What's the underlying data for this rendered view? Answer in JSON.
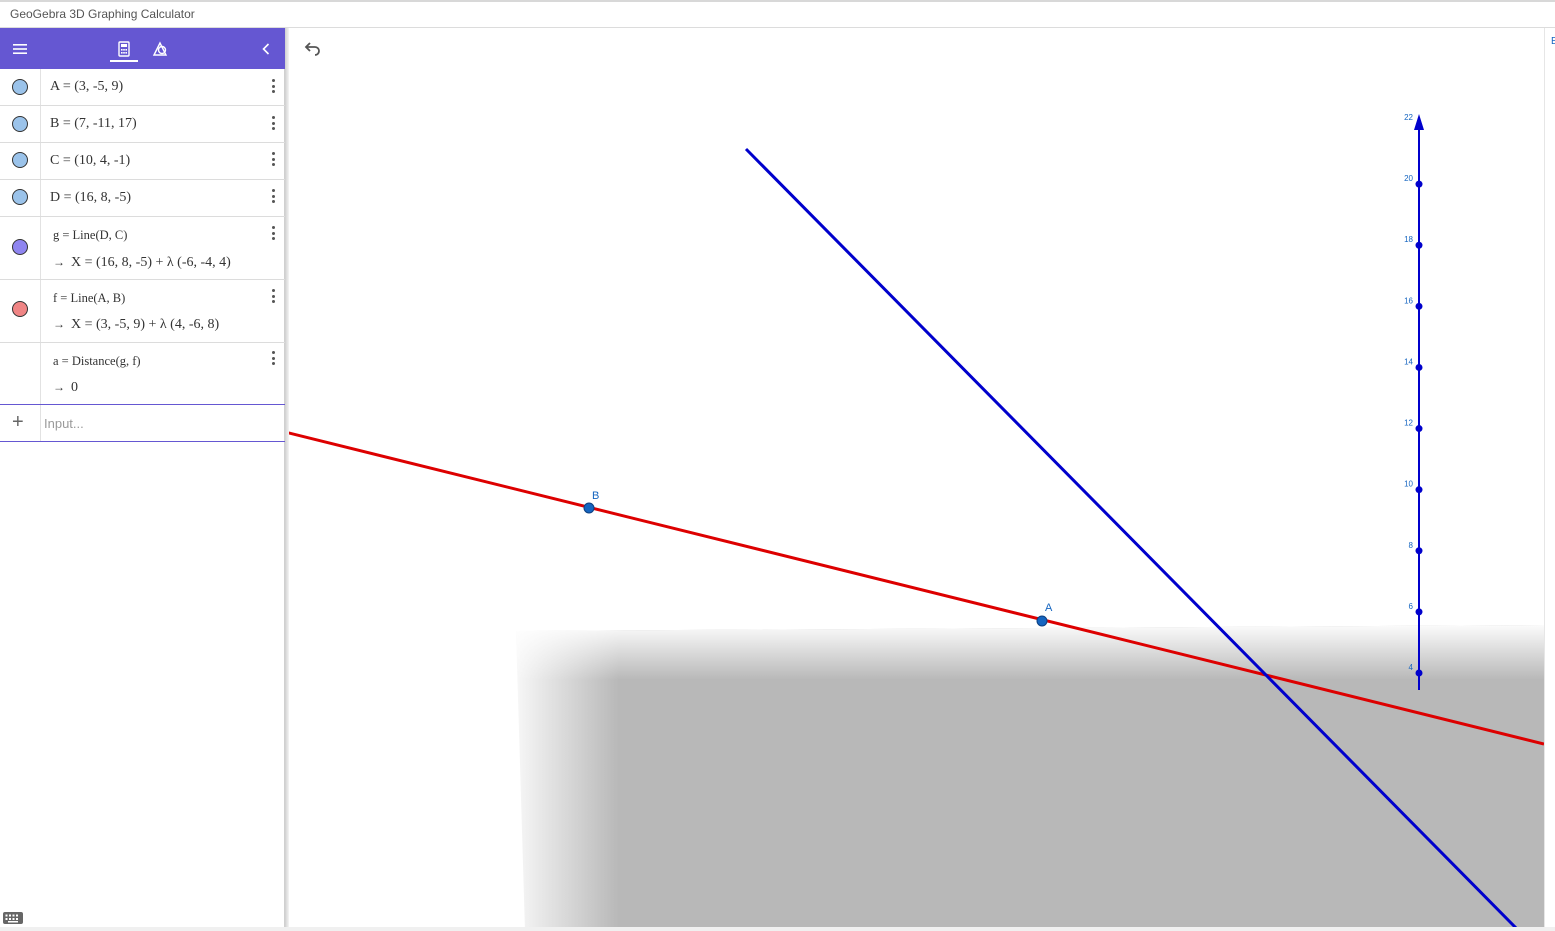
{
  "window": {
    "title": "GeoGebra 3D Graphing Calculator"
  },
  "algebra_view": {
    "rows": [
      {
        "definition": "A = (3, -5, 9)",
        "marble_color": "#9bc3ea",
        "output": ""
      },
      {
        "definition": "B = (7, -11, 17)",
        "marble_color": "#9bc3ea",
        "output": ""
      },
      {
        "definition": "C = (10, 4, -1)",
        "marble_color": "#9bc3ea",
        "output": ""
      },
      {
        "definition": "D = (16, 8, -5)",
        "marble_color": "#9bc3ea",
        "output": ""
      },
      {
        "definition": "g = Line(D, C)",
        "marble_color": "#8f85f0",
        "output": "X = (16, 8, -5) + λ (-6, -4, 4)"
      },
      {
        "definition": "f = Line(A, B)",
        "marble_color": "#f08585",
        "output": "X = (3, -5, 9) + λ (4, -6, 8)"
      },
      {
        "definition": "a = Distance(g, f)",
        "marble_color": "",
        "output": "0"
      }
    ],
    "output_arrow": "→",
    "input": {
      "placeholder": "Input..."
    }
  },
  "graphics_3d": {
    "points": [
      {
        "label": "A"
      },
      {
        "label": "B"
      }
    ],
    "z_axis_ticks": [
      "4",
      "6",
      "8",
      "10",
      "12",
      "14",
      "16",
      "18",
      "20",
      "22"
    ],
    "colors": {
      "line_f": "#dd0000",
      "line_g": "#0000cc",
      "z_axis": "#0000cc",
      "point": "#1565c0",
      "plane": "#b8b8b8",
      "header": "#6557d2"
    }
  },
  "right_edge": {
    "letter": "E"
  }
}
